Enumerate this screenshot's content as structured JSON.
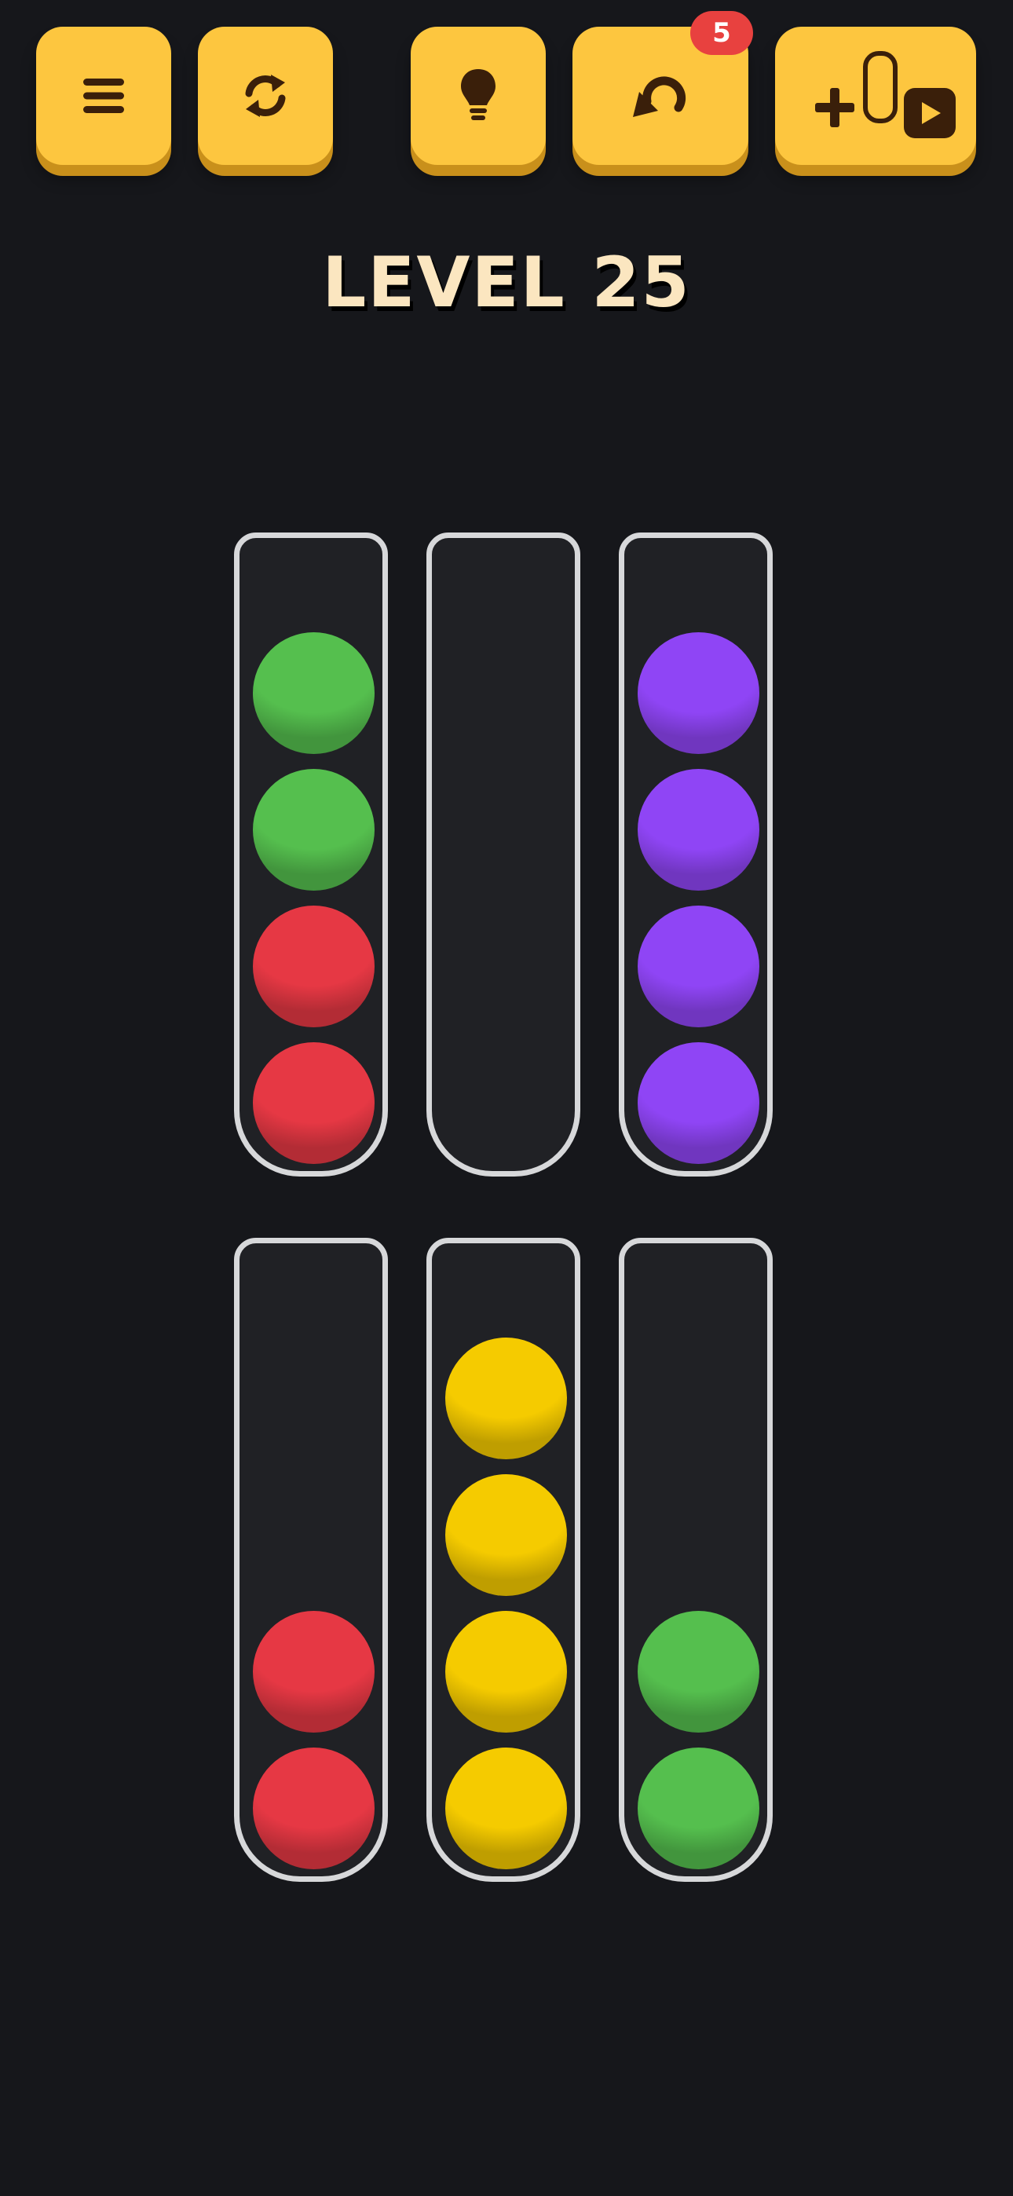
{
  "header": {
    "level_label": "LEVEL 25",
    "undo_count": "5"
  },
  "buttons": [
    {
      "name": "menu-button",
      "icon": "hamburger-menu-icon"
    },
    {
      "name": "restart-button",
      "icon": "refresh-icon"
    },
    {
      "name": "hint-button",
      "icon": "lightbulb-icon"
    },
    {
      "name": "undo-button",
      "icon": "undo-arrow-icon"
    },
    {
      "name": "add-tube-button",
      "icon": "add-tube-video-icon"
    }
  ],
  "tube_capacity": 4,
  "tubes": [
    {
      "balls_top_to_bottom": [
        "green",
        "green",
        "red",
        "red"
      ]
    },
    {
      "balls_top_to_bottom": []
    },
    {
      "balls_top_to_bottom": [
        "purple",
        "purple",
        "purple",
        "purple"
      ]
    },
    {
      "balls_top_to_bottom": [
        "red",
        "red"
      ]
    },
    {
      "balls_top_to_bottom": [
        "yellow",
        "yellow",
        "yellow",
        "yellow"
      ]
    },
    {
      "balls_top_to_bottom": [
        "green",
        "green"
      ]
    }
  ],
  "colors": {
    "background": "#16171b",
    "button": "#fdc63f",
    "button_shadow": "#c9901b",
    "badge": "#e8413f",
    "level_text": "#fbe6c0",
    "tube_outline": "#d7d8da",
    "tube_fill": "#202125",
    "balls": {
      "green": "#55bf4e",
      "red": "#e63844",
      "purple": "#8f45f5",
      "yellow": "#f5cb00"
    }
  }
}
